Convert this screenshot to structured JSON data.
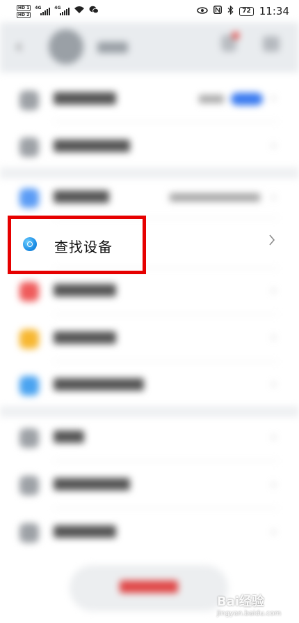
{
  "status_bar": {
    "time": "11:34",
    "battery": "72",
    "network_1": "4G",
    "network_2": "4G"
  },
  "header": {
    "back_icon": "back-arrow-icon",
    "bell_icon": "bell-icon",
    "more_icon": "more-icon"
  },
  "highlighted_item": {
    "label": "查找设备",
    "icon": "find-device-icon"
  },
  "watermark": {
    "brand": "Bai经验",
    "sub": "jingyan.baidu.com"
  },
  "colors": {
    "highlight": "#e60000",
    "find_icon": "#1e8fe6",
    "accent_blue": "#3a7bf0",
    "danger_red": "#e04848"
  }
}
